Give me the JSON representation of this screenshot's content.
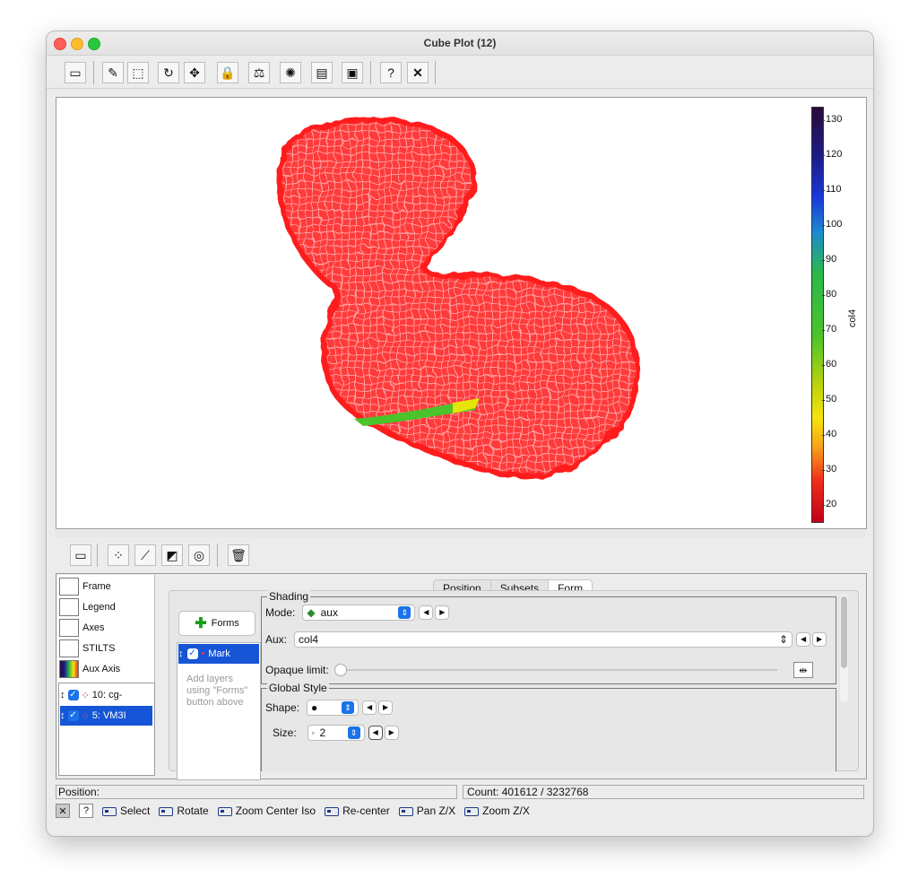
{
  "window": {
    "title": "Cube Plot (12)"
  },
  "colors": {
    "accent": "#1656d6",
    "mesh": "#ff2a2a"
  },
  "toolbar": {
    "icons": [
      "frame-icon",
      "lasso-icon",
      "blob-icon",
      "rotate-icon",
      "pan-icon",
      "lock-icon",
      "lock-weight-icon",
      "density-icon",
      "axes-icon",
      "export-icon",
      "help-icon",
      "close-icon"
    ]
  },
  "colorbar": {
    "label": "col4",
    "ticks": [
      "130",
      "120",
      "110",
      "100",
      "90",
      "80",
      "70",
      "60",
      "50",
      "40",
      "30",
      "20"
    ]
  },
  "control_list": {
    "items": [
      "Frame",
      "Legend",
      "Axes",
      "STILTS",
      "Aux Axis"
    ],
    "layers": [
      "10: cg-",
      "5: VM3I"
    ]
  },
  "tabs": [
    "Position",
    "Subsets",
    "Form"
  ],
  "form": {
    "forms_button": "Forms",
    "selected_form": "Mark",
    "hint": "Add layers using \"Forms\" button above",
    "shading_title": "Shading",
    "mode_label": "Mode:",
    "mode_value": "aux",
    "aux_label": "Aux:",
    "aux_value": "col4",
    "opaque_label": "Opaque limit:",
    "global_title": "Global Style",
    "shape_label": "Shape:",
    "shape_value": "●",
    "size_label": "Size:",
    "size_value": "2"
  },
  "status": {
    "position": "Position:",
    "count": "Count: 401612 / 3232768"
  },
  "mouse_legend": [
    "Select",
    "Rotate",
    "Zoom Center Iso",
    "Re-center",
    "Pan Z/X",
    "Zoom Z/X"
  ]
}
